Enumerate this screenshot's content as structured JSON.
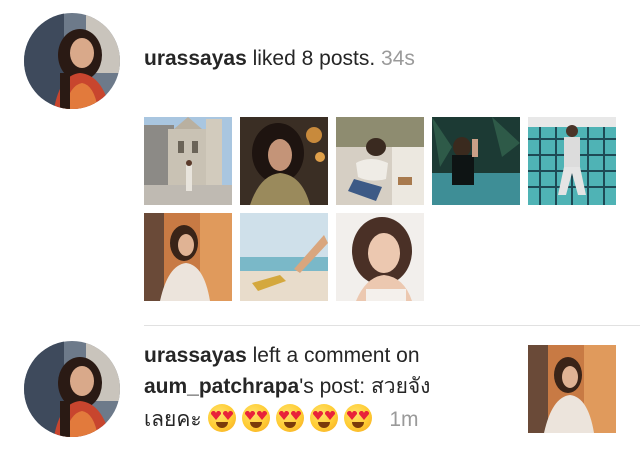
{
  "items": [
    {
      "username": "urassayas",
      "action_text": " liked 8 posts.",
      "time": "34s",
      "avatar_icon": "user-avatar-photo"
    },
    {
      "username": "urassayas",
      "action_text": " left a comment on",
      "post_owner": "aum_patchrapa",
      "post_suffix": "'s post: ",
      "comment_line1": "สวยจัง",
      "comment_line2": "เลยคะ",
      "comment_emoji": "heart-eyes-emoji",
      "time": "1m",
      "avatar_icon": "user-avatar-photo"
    }
  ],
  "colors": {
    "text": "#262626",
    "muted": "#9a9a9a",
    "divider": "#e1e1e1"
  }
}
